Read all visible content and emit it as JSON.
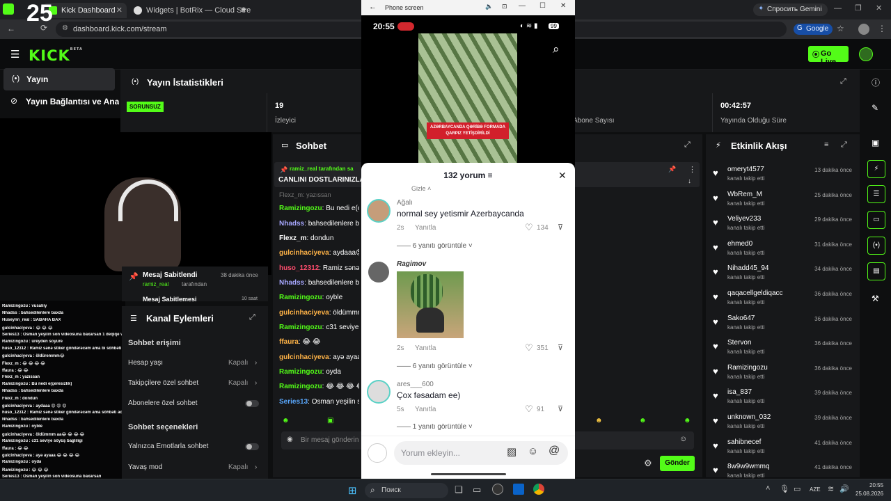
{
  "overlay_number": "25",
  "browser": {
    "tabs": [
      {
        "title": "Kick Dashboard"
      },
      {
        "title": "Widgets | BotRix — Cloud Strea"
      }
    ],
    "url": "dashboard.kick.com/stream",
    "gemini_label": "Спросить Gemini",
    "google_label": "Google"
  },
  "kick": {
    "logo": "KICK",
    "logo_badge": "BETA",
    "go_live": "Go Live",
    "nav": [
      {
        "label": "Yayın"
      },
      {
        "label": "Yayın Bağlantısı ve Anahtarı"
      }
    ],
    "stats": {
      "title": "Yayın İstatistikleri",
      "badge": "SORUNSUZ",
      "viewers_value": "19",
      "viewers_label": "İzleyici",
      "subs_label": "Abone Sayısı",
      "uptime_value": "00:42:57",
      "uptime_label": "Yayında Olduğu Süre"
    },
    "pinned": {
      "title": "Mesaj Sabitlendi",
      "by_user": "ramiz_real",
      "by_suffix": "tarafından",
      "time": "38 dakika önce",
      "next_title": "Mesaj Sabitlemesi",
      "next_time": "10 saat"
    },
    "channel_actions": {
      "title": "Kanal Eylemleri",
      "chat_access_heading": "Sohbet erişimi",
      "account_age": "Hesap yaşı",
      "account_age_value": "Kapalı",
      "followers_chat": "Takipçilere özel sohbet",
      "followers_chat_value": "Kapalı",
      "subscribers_chat": "Abonelere özel sohbet",
      "chat_options_heading": "Sohbet seçenekleri",
      "emotes_only": "Yalnızca Emotlarla sohbet",
      "slow_mode": "Yavaş mod",
      "slow_mode_value": "Kapalı"
    },
    "chat": {
      "title": "Sohbet",
      "pinned_by": "ramiz_real tarafından sa",
      "pinned_text": "CANLINI DOSTLARINIZLA",
      "partial_top": "Flexz_m: yazıssan",
      "messages": [
        {
          "user": "Ramizingozu",
          "text": "Bu nedi e(ça",
          "color": "#53fc18"
        },
        {
          "user": "Nhadss",
          "text": "bahsedilenlere ba",
          "color": "#a7a7ff"
        },
        {
          "user": "Flexz_m",
          "text": "dondun",
          "color": "#ffffff"
        },
        {
          "user": "gulcinhaciyeva",
          "text": "aydaaa😍",
          "color": "#ffb347"
        },
        {
          "user": "huso_12312",
          "text": "Ramiz sənə st",
          "color": "#ff4d6d"
        },
        {
          "user": "Nhadss",
          "text": "bahsedilenlere ba",
          "color": "#a7a7ff"
        },
        {
          "user": "Ramizingozu",
          "text": "oyble",
          "color": "#53fc18"
        },
        {
          "user": "gulcinhaciyeva",
          "text": "öldümmm",
          "color": "#ffb347"
        },
        {
          "user": "Ramizingozu",
          "text": "c31 seviye s",
          "color": "#53fc18"
        },
        {
          "user": "ffaura",
          "text": "😂 😂",
          "color": "#ffb347"
        },
        {
          "user": "gulcinhaciyeva",
          "text": "ayə ayaaa",
          "color": "#ffb347"
        },
        {
          "user": "Ramizingozu",
          "text": "oyda",
          "color": "#53fc18"
        },
        {
          "user": "Ramizingozu",
          "text": "😂 😂 😂 😂",
          "color": "#53fc18"
        },
        {
          "user": "Series13",
          "text": "Osman yeşilin s",
          "color": "#5aa9ff"
        }
      ],
      "input_placeholder": "Bir mesaj gönderin",
      "send": "Gönder"
    },
    "activity": {
      "title": "Etkinlik Akışı",
      "sub": "kanalı takip etti",
      "items": [
        {
          "name": "omeryt4577",
          "time": "13 dakika önce"
        },
        {
          "name": "WbRem_M",
          "time": "25 dakika önce"
        },
        {
          "name": "Veliyev233",
          "time": "29 dakika önce"
        },
        {
          "name": "ehmed0",
          "time": "31 dakika önce"
        },
        {
          "name": "Nihadd45_94",
          "time": "34 dakika önce"
        },
        {
          "name": "qaqacellgeldiqacc",
          "time": "36 dakika önce"
        },
        {
          "name": "Sako647",
          "time": "36 dakika önce"
        },
        {
          "name": "Stervon",
          "time": "36 dakika önce"
        },
        {
          "name": "Ramizingozu",
          "time": "36 dakika önce"
        },
        {
          "name": "isa_837",
          "time": "39 dakika önce"
        },
        {
          "name": "unknown_032",
          "time": "39 dakika önce"
        },
        {
          "name": "sahibnecef",
          "time": "41 dakika önce"
        },
        {
          "name": "8w9w9wmmq",
          "time": "41 dakika önce"
        }
      ]
    }
  },
  "overlay_chat": [
    "Ramizingozu : vusaliiy",
    "Nhadss : bahsedilenlere baxda",
    "Huseynn_real : SABAHA BAX",
    "gulcinhaciyeva : 😂 😂 😂",
    "Series13 : Osman yeşilin son videosuna baxarsan 1 deqiqe video kaliteli",
    "Ramizingozu : ureyden soyure",
    "huso_12312 : Ramiz sənə stiker göndərəcəm ama bi söhbəti affa göndərim",
    "gulcinhaciyeva : öldüremmm😂",
    "Flexz_m : 😂 😂 😂 😂",
    "ffaura : 😂 😂",
    "Flexz_m : yazıssan",
    "Ramizingozu : Bu nedi e(çeresizlik)",
    "Nhadss : bahsedilenlere baxda",
    "Flexz_m : dondun",
    "gulcinhaciyeva : aydaaa 😍 😍 😍",
    "huso_12312 : Ramiz sənə stiker göndərəcəm ama söhbəti acda göndərim",
    "Nhadss : bahsedilenlere baxda",
    "Ramizingozu : oyble",
    "gulcinhaciyeva : öldümmm aa😂 😂 😂 😂",
    "Ramizingozu : c31 seviye söyüş bagliligi",
    "ffaura : 😂 😂",
    "gulcinhaciyeva : ayə ayaaa 😂 😂 😂 😂",
    "Ramizingozu : oyda",
    "Ramizingozu : 😂 😂 😂",
    "Series13 : Osman yeşilin son videosuna baxarsan"
  ],
  "phone": {
    "window_title": "Phone screen",
    "time": "20:55",
    "battery": "99",
    "video_caption": "AZƏRBAYCANDA QƏRİBƏ FORMADA QARPIZ YETİŞDİRİLDİ",
    "comments_count": "132 yorum",
    "hide_label": "Gizle",
    "comments": [
      {
        "user": "Ağalı",
        "text": "normal sey yetismir Azerbaycanda",
        "age": "2s",
        "reply": "Yanıtla",
        "likes": "134",
        "replies": "6 yanıtı görüntüle"
      },
      {
        "user": "Ragimov",
        "text": "",
        "age": "2s",
        "reply": "Yanıtla",
        "likes": "351",
        "replies": "6 yanıtı görüntüle"
      },
      {
        "user": "ares___600",
        "text": "Çox fəsadam ee)",
        "age": "5s",
        "reply": "Yanıtla",
        "likes": "91",
        "replies": "1 yanıtı görüntüle"
      }
    ],
    "input_placeholder": "Yorum ekleyin..."
  },
  "taskbar": {
    "search": "Поиск",
    "lang": "AZE",
    "time": "20:55",
    "date": "25.08.2026"
  },
  "colors": {
    "kick_green": "#53fc18",
    "panel": "#17181a",
    "bg": "#0e0f10"
  }
}
